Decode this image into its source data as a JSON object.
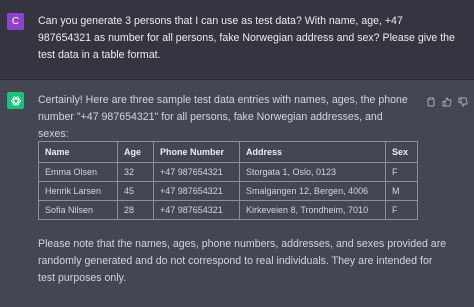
{
  "user": {
    "avatar_letter": "C",
    "avatar_color": "#8c43c9",
    "message": "Can you generate 3 persons that I can use as test data? With name, age, +47 987654321 as number for all persons, fake Norwegian address and sex? Please give the test data in a table format."
  },
  "assistant": {
    "avatar_color": "#19c37d",
    "intro": "Certainly! Here are three sample test data entries with names, ages, the phone number \"+47 987654321\" for all persons, fake Norwegian addresses, and sexes:",
    "table": {
      "headers": [
        "Name",
        "Age",
        "Phone Number",
        "Address",
        "Sex"
      ],
      "rows": [
        [
          "Emma Olsen",
          "32",
          "+47 987654321",
          "Storgata 1, Oslo, 0123",
          "F"
        ],
        [
          "Henrik Larsen",
          "45",
          "+47 987654321",
          "Smalgangen 12, Bergen, 4006",
          "M"
        ],
        [
          "Sofia Nilsen",
          "28",
          "+47 987654321",
          "Kirkeveien 8, Trondheim, 7010",
          "F"
        ]
      ]
    },
    "outro": "Please note that the names, ages, phone numbers, addresses, and sexes provided are randomly generated and do not correspond to real individuals. They are intended for test purposes only.",
    "actions": [
      "copy-icon",
      "thumbs-up-icon",
      "thumbs-down-icon"
    ]
  }
}
